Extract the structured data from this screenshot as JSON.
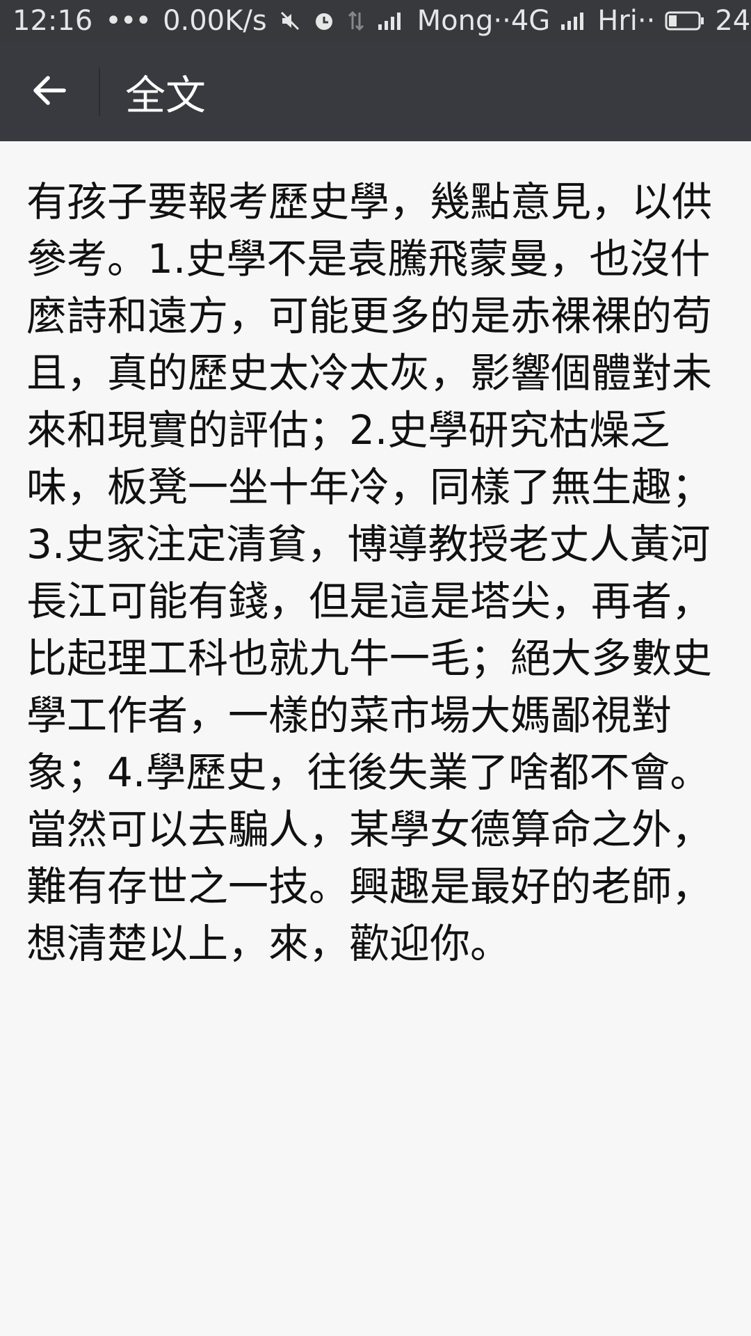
{
  "status_bar": {
    "time": "12:16",
    "more": "•••",
    "net_speed": "0.00K/s",
    "carrier1": "Mong··",
    "network": "4G",
    "carrier2": "Hri··",
    "battery": "24",
    "icons": [
      "mute-icon",
      "alarm-icon",
      "data-arrows-icon",
      "signal-icon",
      "signal-icon",
      "battery-icon"
    ]
  },
  "app_bar": {
    "back_icon": "arrow-left-icon",
    "title": "全文"
  },
  "article": {
    "text": "有孩子要報考歷史學，幾點意見，以供參考。1.史學不是袁騰飛蒙曼，也沒什麼詩和遠方，可能更多的是赤裸裸的苟且，真的歷史太冷太灰，影響個體對未來和現實的評估；2.史學研究枯燥乏味，板凳一坐十年冷，同樣了無生趣；3.史家注定清貧，博導教授老丈人黃河長江可能有錢，但是這是塔尖，再者，比起理工科也就九牛一毛；絕大多數史學工作者，一樣的菜市場大媽鄙視對象；4.學歷史，往後失業了啥都不會。當然可以去騙人，某學女德算命之外，難有存世之一技。興趣是最好的老師，想清楚以上，來，歡迎你。"
  },
  "colors": {
    "status_bar_bg": "#38393d",
    "app_bar_bg": "#393a3f",
    "content_bg": "#f7f7f7",
    "text": "#111111"
  }
}
